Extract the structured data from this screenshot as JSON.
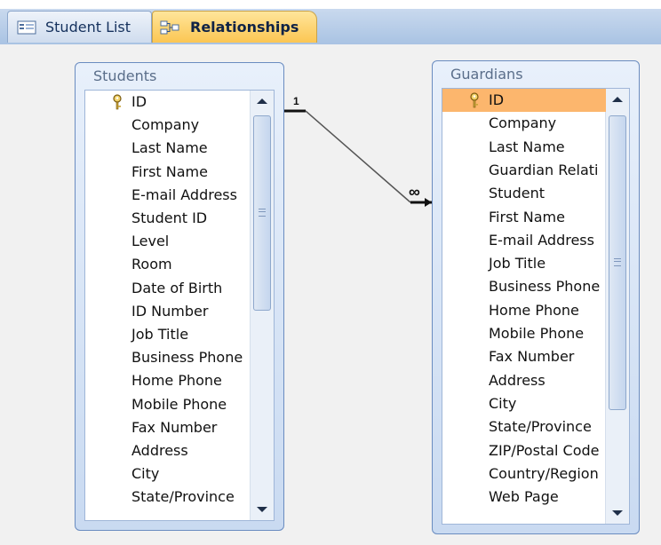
{
  "tabs": [
    {
      "label": "Student List",
      "icon": "form-icon",
      "active": false
    },
    {
      "label": "Relationships",
      "icon": "relationships-icon",
      "active": true
    }
  ],
  "tables": {
    "students": {
      "title": "Students",
      "fields": [
        "ID",
        "Company",
        "Last Name",
        "First Name",
        "E-mail Address",
        "Student ID",
        "Level",
        "Room",
        "Date of Birth",
        "ID Number",
        "Job Title",
        "Business Phone",
        "Home Phone",
        "Mobile Phone",
        "Fax Number",
        "Address",
        "City",
        "State/Province"
      ]
    },
    "guardians": {
      "title": "Guardians",
      "fields": [
        "ID",
        "Company",
        "Last Name",
        "Guardian Relati",
        "Student",
        "First Name",
        "E-mail Address",
        "Job Title",
        "Business Phone",
        "Home Phone",
        "Mobile Phone",
        "Fax Number",
        "Address",
        "City",
        "State/Province",
        "ZIP/Postal Code",
        "Country/Region",
        "Web Page"
      ]
    }
  },
  "relationship": {
    "one_label": "1",
    "many_label": "∞"
  },
  "colors": {
    "accent_tab": "#fbc653",
    "selected_field": "#fcb66d",
    "window_border": "#6a8cc0"
  }
}
